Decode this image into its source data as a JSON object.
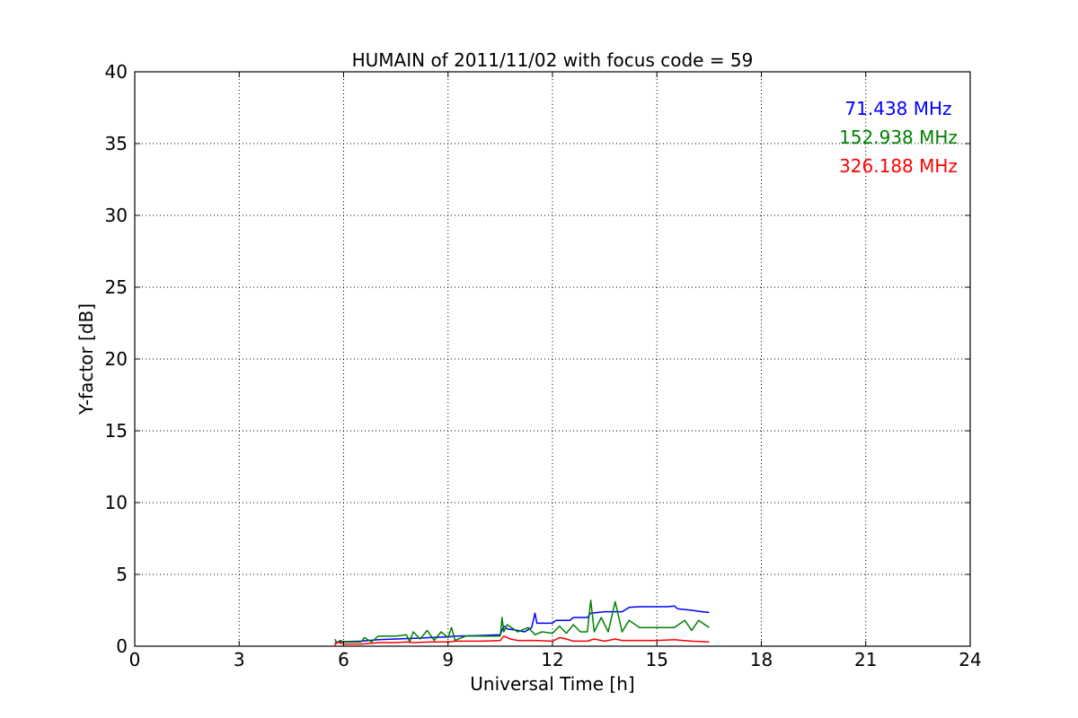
{
  "chart_data": {
    "type": "line",
    "title": "HUMAIN of 2011/11/02 with focus code = 59",
    "xlabel": "Universal Time [h]",
    "ylabel": "Y-factor [dB]",
    "xlim": [
      0,
      24
    ],
    "ylim": [
      0,
      40
    ],
    "xticks": [
      0,
      3,
      6,
      9,
      12,
      15,
      18,
      21,
      24
    ],
    "yticks": [
      0,
      5,
      10,
      15,
      20,
      25,
      30,
      35,
      40
    ],
    "grid": true,
    "legend_position": "top-right",
    "series": [
      {
        "name": "71.438 MHz",
        "color": "#0000ff",
        "x": [
          5.75,
          5.8,
          6.5,
          7.0,
          7.5,
          8.0,
          8.5,
          9.0,
          9.2,
          9.5,
          10.0,
          10.5,
          10.6,
          10.7,
          11.0,
          11.2,
          11.4,
          11.5,
          11.55,
          12.0,
          12.1,
          12.5,
          12.6,
          13.0,
          13.1,
          13.5,
          14.0,
          14.2,
          14.5,
          15.0,
          15.3,
          15.5,
          15.6,
          16.0,
          16.3,
          16.5
        ],
        "y": [
          0.2,
          0.3,
          0.35,
          0.45,
          0.5,
          0.55,
          0.6,
          0.65,
          0.7,
          0.72,
          0.75,
          0.8,
          1.4,
          1.2,
          1.1,
          1.0,
          1.3,
          2.3,
          1.6,
          1.6,
          1.8,
          1.8,
          2.0,
          2.0,
          2.3,
          2.4,
          2.4,
          2.7,
          2.75,
          2.75,
          2.75,
          2.8,
          2.6,
          2.5,
          2.4,
          2.35
        ]
      },
      {
        "name": "152.938 MHz",
        "color": "#008000",
        "x": [
          5.75,
          5.8,
          5.9,
          6.0,
          6.5,
          6.6,
          6.8,
          7.0,
          7.5,
          7.8,
          7.9,
          8.0,
          8.2,
          8.4,
          8.6,
          8.8,
          9.0,
          9.1,
          9.2,
          9.5,
          10.0,
          10.5,
          10.55,
          10.6,
          10.7,
          11.0,
          11.3,
          11.5,
          11.7,
          12.0,
          12.2,
          12.4,
          12.6,
          12.8,
          13.0,
          13.1,
          13.2,
          13.4,
          13.6,
          13.8,
          14.0,
          14.2,
          14.5,
          15.0,
          15.5,
          15.8,
          16.0,
          16.2,
          16.5
        ],
        "y": [
          0.5,
          0.2,
          0.4,
          0.3,
          0.3,
          0.6,
          0.3,
          0.7,
          0.7,
          0.8,
          0.3,
          1.0,
          0.5,
          1.1,
          0.4,
          1.0,
          0.6,
          1.3,
          0.4,
          0.7,
          0.7,
          0.7,
          2.0,
          1.0,
          1.5,
          1.0,
          1.3,
          0.8,
          1.0,
          0.9,
          1.4,
          0.9,
          1.5,
          1.0,
          1.0,
          3.2,
          1.0,
          2.0,
          1.0,
          3.1,
          1.0,
          1.8,
          1.3,
          1.3,
          1.3,
          1.8,
          1.1,
          1.8,
          1.3
        ]
      },
      {
        "name": "326.188 MHz",
        "color": "#ff0000",
        "x": [
          5.75,
          5.8,
          6.0,
          6.5,
          6.8,
          7.0,
          7.5,
          7.8,
          8.0,
          8.5,
          9.0,
          9.2,
          9.5,
          10.0,
          10.5,
          10.6,
          10.8,
          11.0,
          11.5,
          12.0,
          12.2,
          12.4,
          12.6,
          13.0,
          13.2,
          13.5,
          13.8,
          14.0,
          14.5,
          15.0,
          15.5,
          16.0,
          16.5
        ],
        "y": [
          0.05,
          0.3,
          0.15,
          0.15,
          0.2,
          0.25,
          0.25,
          0.3,
          0.25,
          0.3,
          0.3,
          0.35,
          0.35,
          0.35,
          0.4,
          0.7,
          0.5,
          0.4,
          0.4,
          0.35,
          0.6,
          0.5,
          0.35,
          0.35,
          0.5,
          0.35,
          0.5,
          0.4,
          0.4,
          0.4,
          0.45,
          0.35,
          0.3
        ]
      }
    ]
  }
}
